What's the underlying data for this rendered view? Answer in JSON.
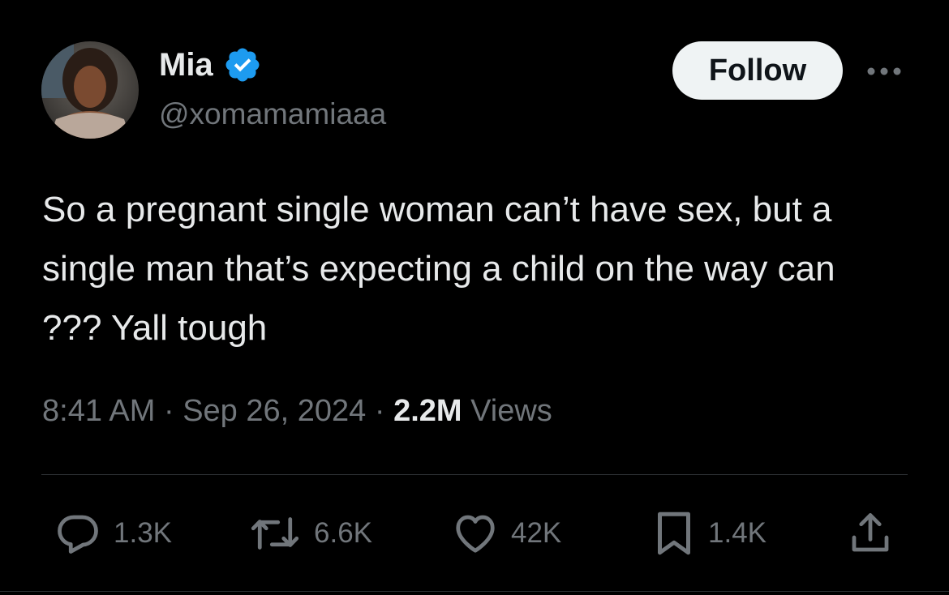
{
  "author": {
    "name": "Mia",
    "handle": "@xomamamiaaa",
    "verified_icon": "verified-badge-icon",
    "verified_color": "#1d9bf0"
  },
  "follow_button": {
    "label": "Follow"
  },
  "more_menu": {
    "icon": "more-horizontal-icon"
  },
  "tweet": {
    "text": "So a pregnant single woman can’t have sex, but a single man that’s expecting a child on the way can ??? Yall tough"
  },
  "meta": {
    "time": "8:41 AM",
    "separator": "·",
    "date": "Sep 26, 2024",
    "views_count": "2.2M",
    "views_label": "Views"
  },
  "actions": {
    "reply": {
      "icon": "reply-icon",
      "count": "1.3K"
    },
    "repost": {
      "icon": "repost-icon",
      "count": "6.6K"
    },
    "like": {
      "icon": "heart-icon",
      "count": "42K"
    },
    "bookmark": {
      "icon": "bookmark-icon",
      "count": "1.4K"
    },
    "share": {
      "icon": "share-icon"
    }
  },
  "colors": {
    "background": "#000000",
    "primary_text": "#e7e9ea",
    "secondary_text": "#71767b",
    "divider": "#2f3336",
    "follow_bg": "#eff3f4"
  }
}
